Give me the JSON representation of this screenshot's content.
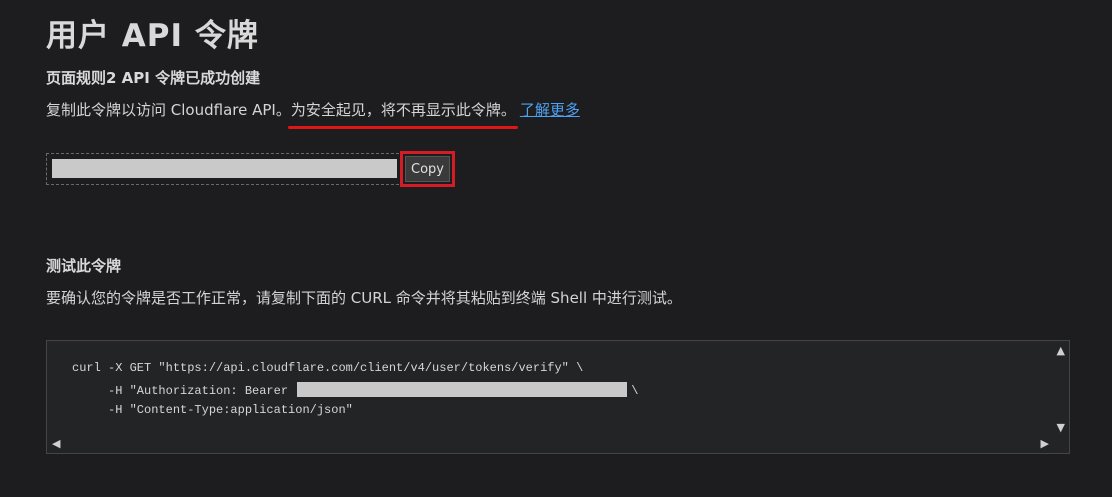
{
  "page": {
    "title": "用户 API 令牌"
  },
  "success": {
    "title": "页面规则2 API 令牌已成功创建",
    "desc_before": "复制此令牌以访问 Cloudflare API。",
    "desc_warning": "为安全起见，将不再显示此令牌。",
    "learn_more": "了解更多"
  },
  "token": {
    "value": "",
    "copy_label": "Copy"
  },
  "test": {
    "title": "测试此令牌",
    "desc": "要确认您的令牌是否工作正常，请复制下面的 CURL 命令并将其粘贴到终端 Shell 中进行测试。",
    "code_line1": "curl -X GET \"https://api.cloudflare.com/client/v4/user/tokens/verify\" \\",
    "code_line2_prefix": "     -H \"Authorization: Bearer ",
    "code_line2_suffix": "\\",
    "code_line3": "     -H \"Content-Type:application/json\""
  },
  "icons": {
    "scroll_up": "▲",
    "scroll_down": "▼",
    "scroll_left": "◀",
    "scroll_right": "▶"
  },
  "colors": {
    "background": "#1d1d1f",
    "link": "#4ea1f3",
    "highlight": "#d41c24",
    "redaction": "#c9c9c9"
  }
}
